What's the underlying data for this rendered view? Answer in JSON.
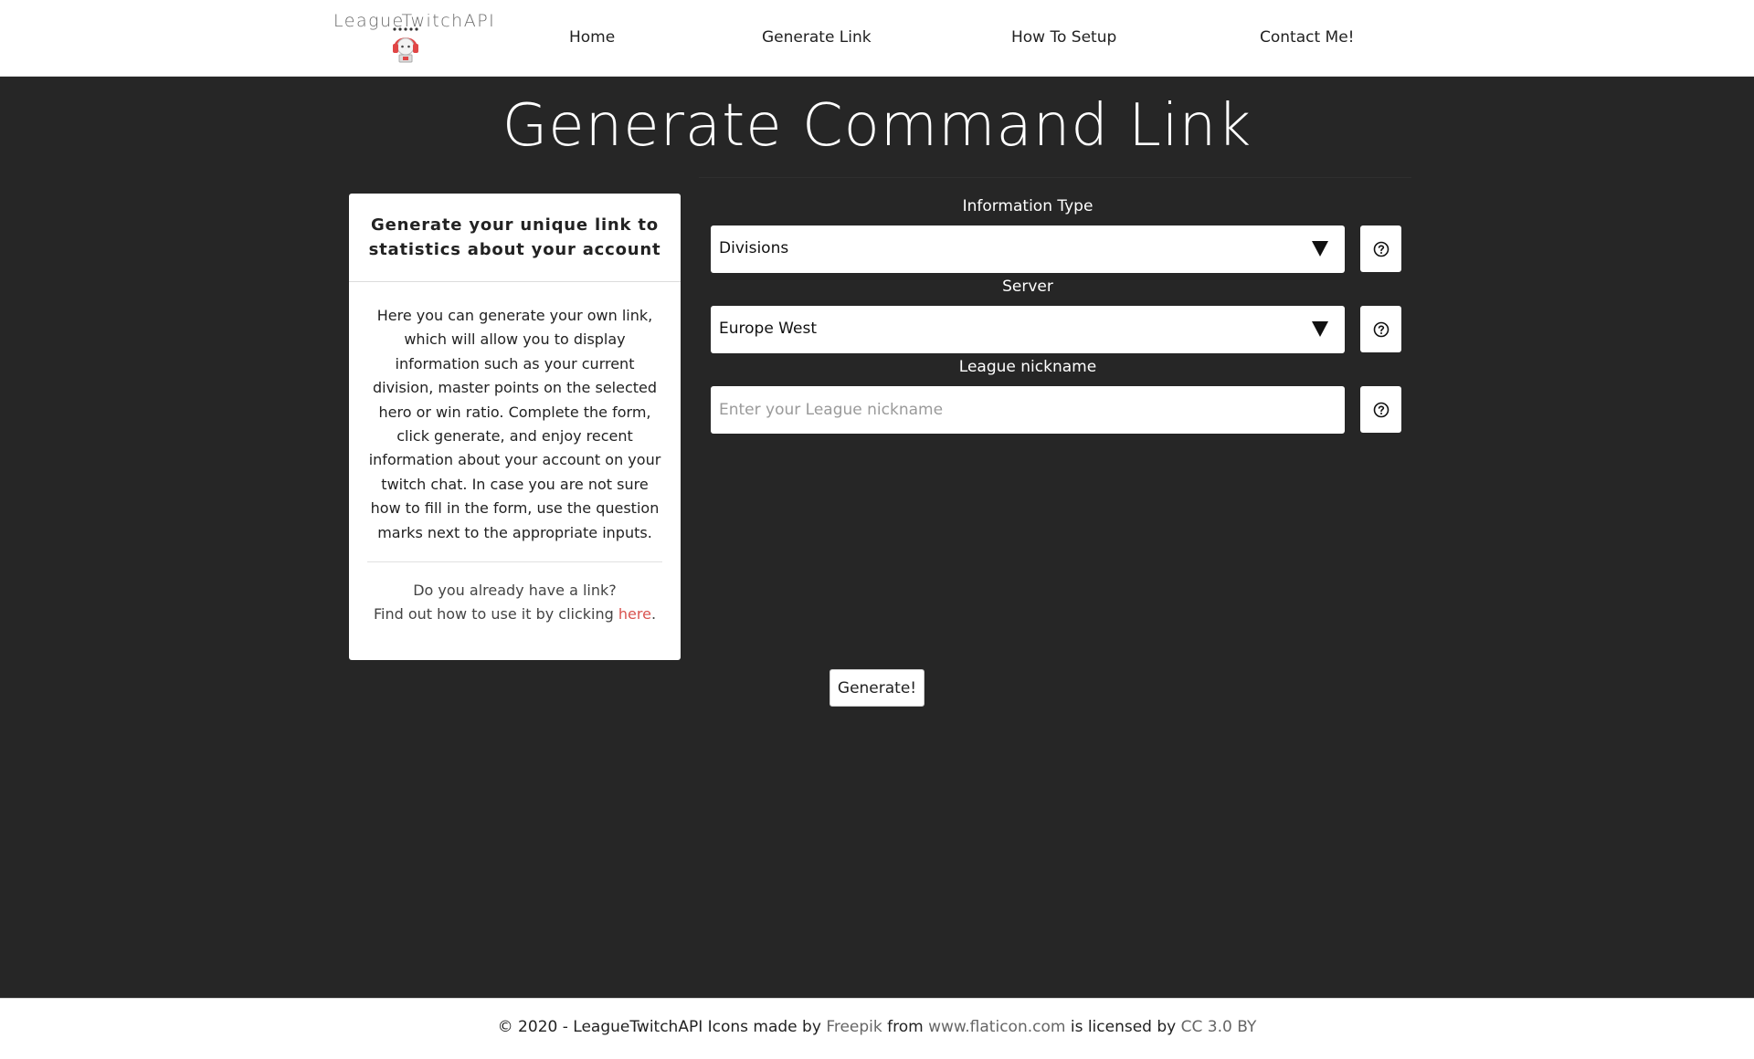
{
  "header": {
    "logo_text": "LeagueTwitchAPI",
    "nav": [
      {
        "label": "Home"
      },
      {
        "label": "Generate Link"
      },
      {
        "label": "How To Setup"
      },
      {
        "label": "Contact Me!"
      }
    ]
  },
  "main": {
    "title": "Generate Command Link",
    "card": {
      "header": "Generate your unique link to statistics about your account",
      "body": "Here you can generate your own link, which will allow you to display information such as your current division, master points on the selected hero or win ratio. Complete the form, click generate, and enjoy recent information about your account on your twitch chat. In case you are not sure how to fill in the form, use the question marks next to the appropriate inputs.",
      "footer_line1": "Do you already have a link?",
      "footer_line2_prefix": "Find out how to use it by clicking ",
      "footer_link": "here",
      "footer_line2_suffix": "."
    },
    "form": {
      "info_type_label": "Information Type",
      "info_type_value": "Divisions",
      "server_label": "Server",
      "server_value": "Europe West",
      "nickname_label": "League nickname",
      "nickname_placeholder": "Enter your League nickname",
      "nickname_value": ""
    },
    "generate_label": "Generate!"
  },
  "footer": {
    "prefix": "© 2020 - LeagueTwitchAPI Icons made by ",
    "author_link": "Freepik",
    "from_text": " from ",
    "site_link": "www.flaticon.com",
    "licensed_text": " is licensed by ",
    "license_link": "CC 3.0 BY"
  },
  "colors": {
    "background": "#262626",
    "accent_link": "#d9534f",
    "surface": "#ffffff"
  }
}
